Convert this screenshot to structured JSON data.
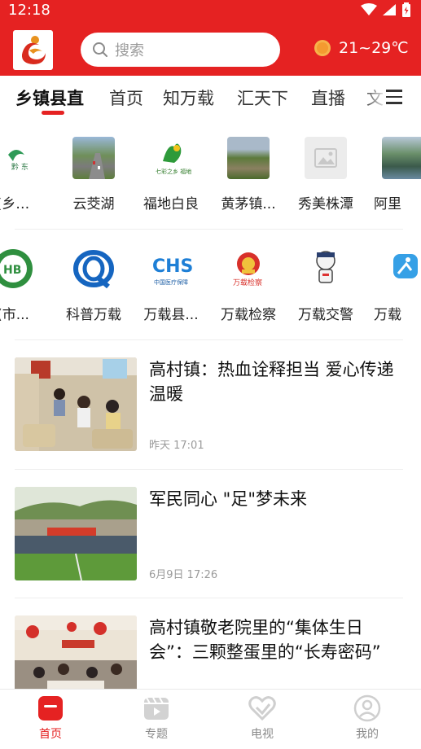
{
  "status_bar": {
    "time": "12:18"
  },
  "header": {
    "search_placeholder": "搜索",
    "weather": {
      "temp": "21~29℃",
      "icon": "sun-icon"
    }
  },
  "tabs": [
    {
      "label": "乡镇县直",
      "active": true
    },
    {
      "label": "首页"
    },
    {
      "label": "知万载"
    },
    {
      "label": "汇天下"
    },
    {
      "label": "直播"
    },
    {
      "label": "文"
    }
  ],
  "grid_row_1": [
    {
      "label": "(乡…",
      "icon": "town-logo-partial"
    },
    {
      "label": "云茭湖",
      "icon": "highway-photo"
    },
    {
      "label": "福地白良",
      "icon": "bailiang-logo"
    },
    {
      "label": "黄茅镇...",
      "icon": "landscape-photo"
    },
    {
      "label": "秀美株潭",
      "icon": "placeholder-image-icon"
    },
    {
      "label": "阿里",
      "icon": "lake-photo"
    }
  ],
  "grid_row_2": [
    {
      "label": "(市...",
      "icon": "green-seal-logo"
    },
    {
      "label": "科普万载",
      "icon": "science-logo"
    },
    {
      "label": "万载县...",
      "icon": "chs-medical-logo"
    },
    {
      "label": "万载检察",
      "icon": "procuratorate-emblem"
    },
    {
      "label": "万载交警",
      "icon": "traffic-police-mascot"
    },
    {
      "label": "万载",
      "icon": "blue-figure-logo"
    }
  ],
  "news": [
    {
      "title": "高村镇：热血诠释担当 爱心传递温暖",
      "time": "昨天 17:01"
    },
    {
      "title": "军民同心  \"足\"梦未来",
      "time": "6月9日 17:26"
    },
    {
      "title": "高村镇敬老院里的“集体生日会”：三颗整蛋里的“长寿密码”",
      "time": ""
    }
  ],
  "bottom_nav": [
    {
      "label": "首页",
      "icon": "home-icon",
      "active": true
    },
    {
      "label": "专题",
      "icon": "topic-icon"
    },
    {
      "label": "电视",
      "icon": "tv-icon"
    },
    {
      "label": "我的",
      "icon": "profile-icon"
    }
  ],
  "colors": {
    "brand_red": "#e52222"
  }
}
